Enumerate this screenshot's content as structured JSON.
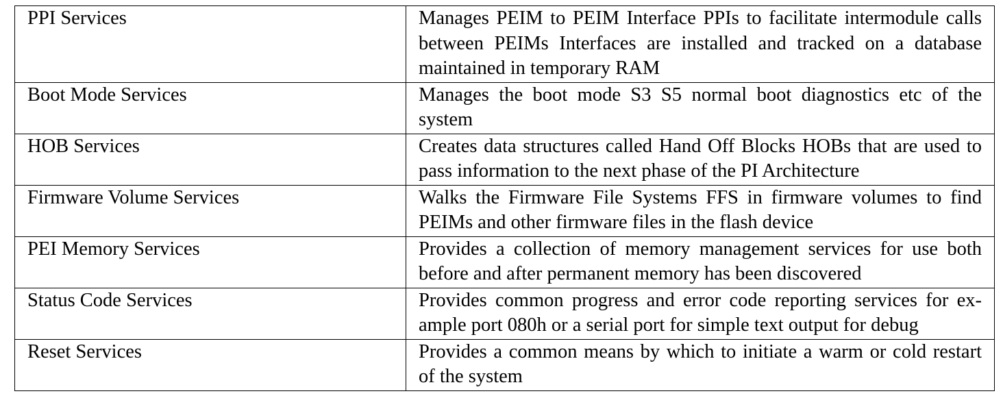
{
  "rows": [
    {
      "service": "PPI Services",
      "description": "Manages PEIM to PEIM Interface PPIs to facilitate intermodule calls between PEIMs Interfaces are installed and tracked on a database maintained in temporary RAM"
    },
    {
      "service": "Boot Mode Services",
      "description": "Manages the boot mode S3 S5 normal boot diagnostics etc of the system"
    },
    {
      "service": "HOB Services",
      "description": "Creates data structures called Hand Off Blocks HOBs that are used to pass information to the next phase of the PI Architecture"
    },
    {
      "service": "Firmware Volume Services",
      "description": "Walks the Firmware File Systems FFS in firmware volumes to find PEIMs and other firmware files in the flash device"
    },
    {
      "service": "PEI Memory Services",
      "description": "Provides a collection of memory management services for use both before and after permanent memory has been discovered"
    },
    {
      "service": "Status Code Services",
      "description": "Provides common progress and error code reporting services for ex­ample port 080h or a serial port for simple text output for debug"
    },
    {
      "service": "Reset Services",
      "description": "Provides a common means by which to initiate a warm or cold restart of the system"
    }
  ]
}
